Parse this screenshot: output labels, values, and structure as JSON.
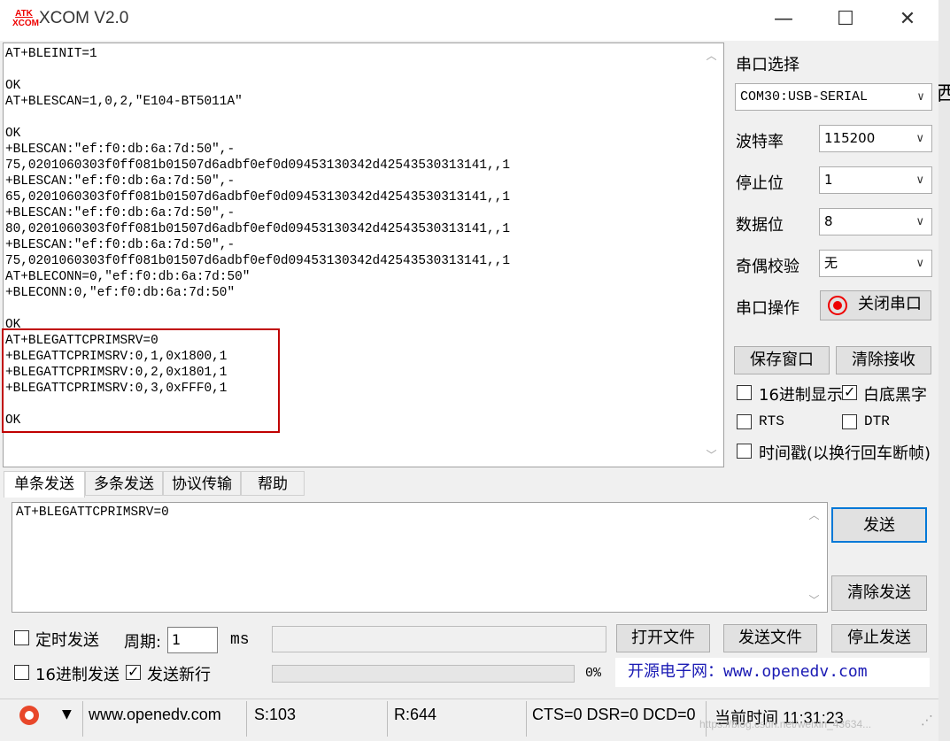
{
  "window": {
    "title": "XCOM V2.0",
    "logo_top": "ATK",
    "logo_bottom": "XCOM",
    "minimize_glyph": "—",
    "maximize_glyph": "☐",
    "close_glyph": "✕"
  },
  "receive": {
    "text": "AT+BLEINIT=1\n\nOK\nAT+BLESCAN=1,0,2,\"E104-BT5011A\"\n\nOK\n+BLESCAN:\"ef:f0:db:6a:7d:50\",-\n75,0201060303f0ff081b01507d6adbf0ef0d09453130342d42543530313141,,1\n+BLESCAN:\"ef:f0:db:6a:7d:50\",-\n65,0201060303f0ff081b01507d6adbf0ef0d09453130342d42543530313141,,1\n+BLESCAN:\"ef:f0:db:6a:7d:50\",-\n80,0201060303f0ff081b01507d6adbf0ef0d09453130342d42543530313141,,1\n+BLESCAN:\"ef:f0:db:6a:7d:50\",-\n75,0201060303f0ff081b01507d6adbf0ef0d09453130342d42543530313141,,1\nAT+BLECONN=0,\"ef:f0:db:6a:7d:50\"\n+BLECONN:0,\"ef:f0:db:6a:7d:50\"\n\nOK\nAT+BLEGATTCPRIMSRV=0\n+BLEGATTCPRIMSRV:0,1,0x1800,1\n+BLEGATTCPRIMSRV:0,2,0x1801,1\n+BLEGATTCPRIMSRV:0,3,0xFFF0,1\n\nOK"
  },
  "settings": {
    "section_title": "串口选择",
    "port_value": "COM30:USB-SERIAL",
    "baud_label": "波特率",
    "baud_value": "115200",
    "stopbits_label": "停止位",
    "stopbits_value": "1",
    "databits_label": "数据位",
    "databits_value": "8",
    "parity_label": "奇偶校验",
    "parity_value": "无",
    "port_op_label": "串口操作",
    "port_op_button": "关闭串口",
    "save_window": "保存窗口",
    "clear_receive": "清除接收",
    "hex_display": "16进制显示",
    "white_black": "白底黑字",
    "rts": "RTS",
    "dtr": "DTR",
    "timestamp": "时间戳(以换行回车断帧)"
  },
  "right_edge_char": "西",
  "tabs": [
    "单条发送",
    "多条发送",
    "协议传输",
    "帮助"
  ],
  "send": {
    "text": "AT+BLEGATTCPRIMSRV=0",
    "send_button": "发送",
    "clear_send_button": "清除发送"
  },
  "options": {
    "timed_send": "定时发送",
    "period_label": "周期:",
    "period_value": "1",
    "period_unit": "ms",
    "open_file": "打开文件",
    "send_file": "发送文件",
    "stop_send": "停止发送",
    "hex_send": "16进制发送",
    "send_newline": "发送新行",
    "progress_text": "0%",
    "progress_value": 0,
    "banner": "开源电子网：www.openedv.com"
  },
  "status": {
    "url": "www.openedv.com",
    "sent": "S:103",
    "received": "R:644",
    "lines": "CTS=0 DSR=0 DCD=0",
    "time": "当前时间 11:31:23",
    "watermark": "https://blog.csdn.net/weixin_43634..."
  },
  "colors": {
    "highlight_border": "#c00000",
    "banner_text": "#1a1ab4",
    "logo": "#e00000"
  }
}
